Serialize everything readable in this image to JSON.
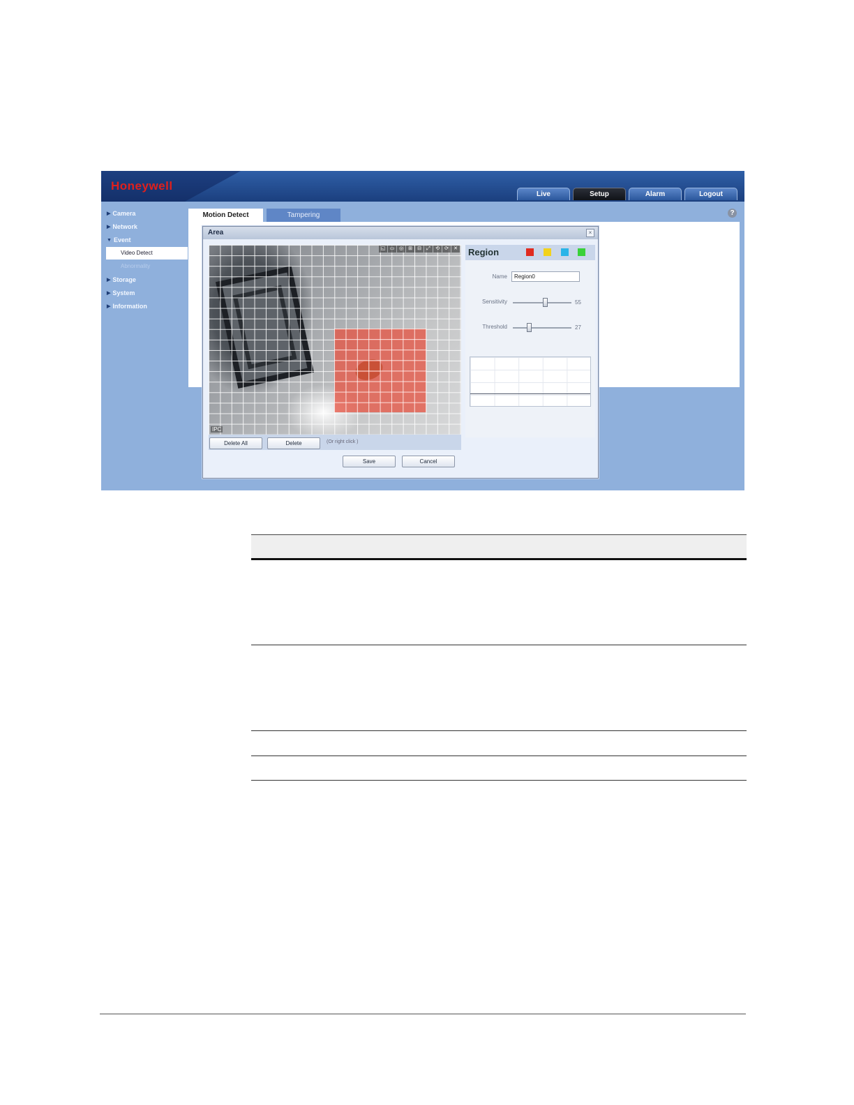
{
  "app": {
    "brand": "Honeywell",
    "nav_tabs": [
      "Live",
      "Setup",
      "Alarm",
      "Logout"
    ],
    "active_nav": "Setup"
  },
  "sidebar": {
    "items": [
      {
        "label": "Camera",
        "expanded": false
      },
      {
        "label": "Network",
        "expanded": false
      },
      {
        "label": "Event",
        "expanded": true
      },
      {
        "label": "Storage",
        "expanded": false
      },
      {
        "label": "System",
        "expanded": false
      },
      {
        "label": "Information",
        "expanded": false
      }
    ],
    "event_children": [
      "Video Detect",
      "Abnormality"
    ]
  },
  "content": {
    "tabs": [
      "Motion Detect",
      "Tampering"
    ],
    "active_tab": "Motion Detect",
    "help_icon": "?"
  },
  "dialog": {
    "title": "Area",
    "close_glyph": "×",
    "video_tools": [
      "◱",
      "▭",
      "◎",
      "⊞",
      "⊟",
      "⤢",
      "⟲",
      "⟳",
      "✕"
    ],
    "video_label": "IPC",
    "delete_all_label": "Delete All",
    "delete_label": "Delete",
    "hint": "(Or right click )",
    "save_label": "Save",
    "cancel_label": "Cancel",
    "region_fill_color": "#e74e3c"
  },
  "region": {
    "title": "Region",
    "colors": [
      "#e02b20",
      "#f2d21c",
      "#2ab4e8",
      "#39d139"
    ],
    "name_label": "Name",
    "name_value": "Region0",
    "sensitivity_label": "Sensitivity",
    "sensitivity_value": "55",
    "sensitivity_fraction": 0.55,
    "threshold_label": "Threshold",
    "threshold_value": "27",
    "threshold_fraction": 0.27
  }
}
